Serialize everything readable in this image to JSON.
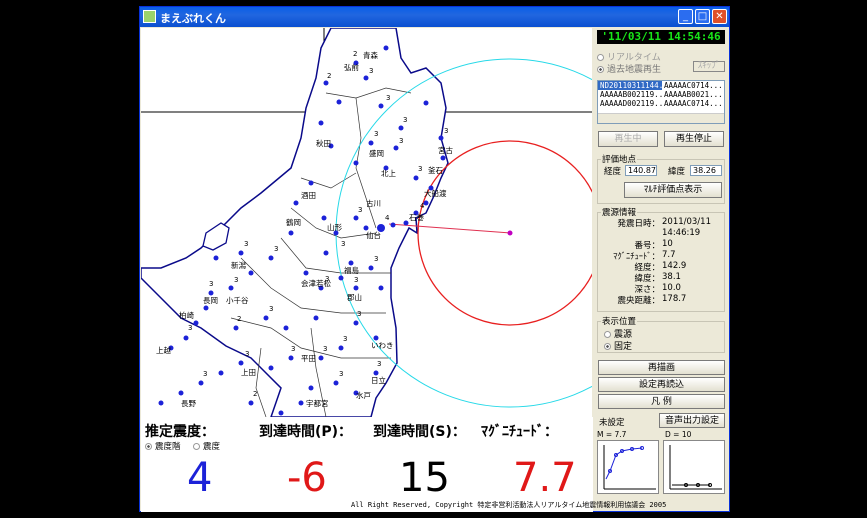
{
  "window": {
    "title": "まえぶれくん"
  },
  "clock": "'11/03/11 14:54:46",
  "modes": {
    "realtime": "リアルタイム",
    "past": "過去地震再生",
    "other_btn": "ｽｷｯﾌﾟ"
  },
  "event_list": [
    [
      "ND20110311144...",
      "AAAAAC0714..."
    ],
    [
      "AAAAAB002119...",
      "AAAAAB0021..."
    ],
    [
      "AAAAAD002119...",
      "AAAAAC0714..."
    ]
  ],
  "buttons": {
    "playing": "再生中",
    "stop": "再生停止",
    "multi": "ﾏﾙﾁ評価点表示",
    "redraw": "再描画",
    "reload": "設定再読込",
    "legend": "凡 例",
    "sound": "音声出力設定"
  },
  "eval_point": {
    "caption": "評価地点",
    "lon_label": "経度",
    "lon": "140.87",
    "lat_label": "緯度",
    "lat": "38.26"
  },
  "source_info": {
    "caption": "震源情報",
    "rows": [
      {
        "k": "発震日時：",
        "v": "2011/03/11"
      },
      {
        "k": "",
        "v": "14:46:19"
      },
      {
        "k": "番号：",
        "v": "10"
      },
      {
        "k": "ﾏｸﾞﾆﾁｭｰﾄﾞ：",
        "v": "7.7"
      },
      {
        "k": "経度：",
        "v": "142.9"
      },
      {
        "k": "緯度：",
        "v": "38.1"
      },
      {
        "k": "深さ：",
        "v": "10.0"
      },
      {
        "k": "震央距離：",
        "v": "178.7"
      }
    ]
  },
  "display_pos": {
    "caption": "表示位置",
    "opt1": "震源",
    "opt2": "固定"
  },
  "unset": "未設定",
  "graph_labels": {
    "m": "M = 7.7",
    "d": "D = 10"
  },
  "bottom": {
    "intensity_label": "推定震度：",
    "p_label": "到達時間(P)：",
    "s_label": "到達時間(S)：",
    "mag_label": "ﾏｸﾞﾆﾁｭｰﾄﾞ：",
    "opt_a": "震度階",
    "opt_b": "震度",
    "intensity": "4",
    "p_time": "-6",
    "s_time": "15",
    "magnitude": "7.7",
    "copyright": "All Right Reserved, Copyright 特定非営利活動法人リアルタイム地震情報利用協議会 2005"
  },
  "map": {
    "cities": [
      "弘前",
      "青森",
      "秋田",
      "盛岡",
      "宮古",
      "北上",
      "釜石",
      "大船渡",
      "酒田",
      "鶴岡",
      "山形",
      "仙台",
      "石巻",
      "福島",
      "会津若松",
      "郡山",
      "いわき",
      "新潟",
      "長岡",
      "柏崎",
      "小千谷",
      "上越",
      "日立",
      "水戸",
      "宇都宮",
      "平田",
      "古川",
      "上田",
      "長野"
    ],
    "colors": {
      "intensity_blue": "#1c22d8",
      "p_red": "#e01818",
      "mag_red": "#e01818",
      "s_circle": "#e82020",
      "p_circle": "#27d9e8",
      "epicenter": "#c000c0"
    }
  }
}
